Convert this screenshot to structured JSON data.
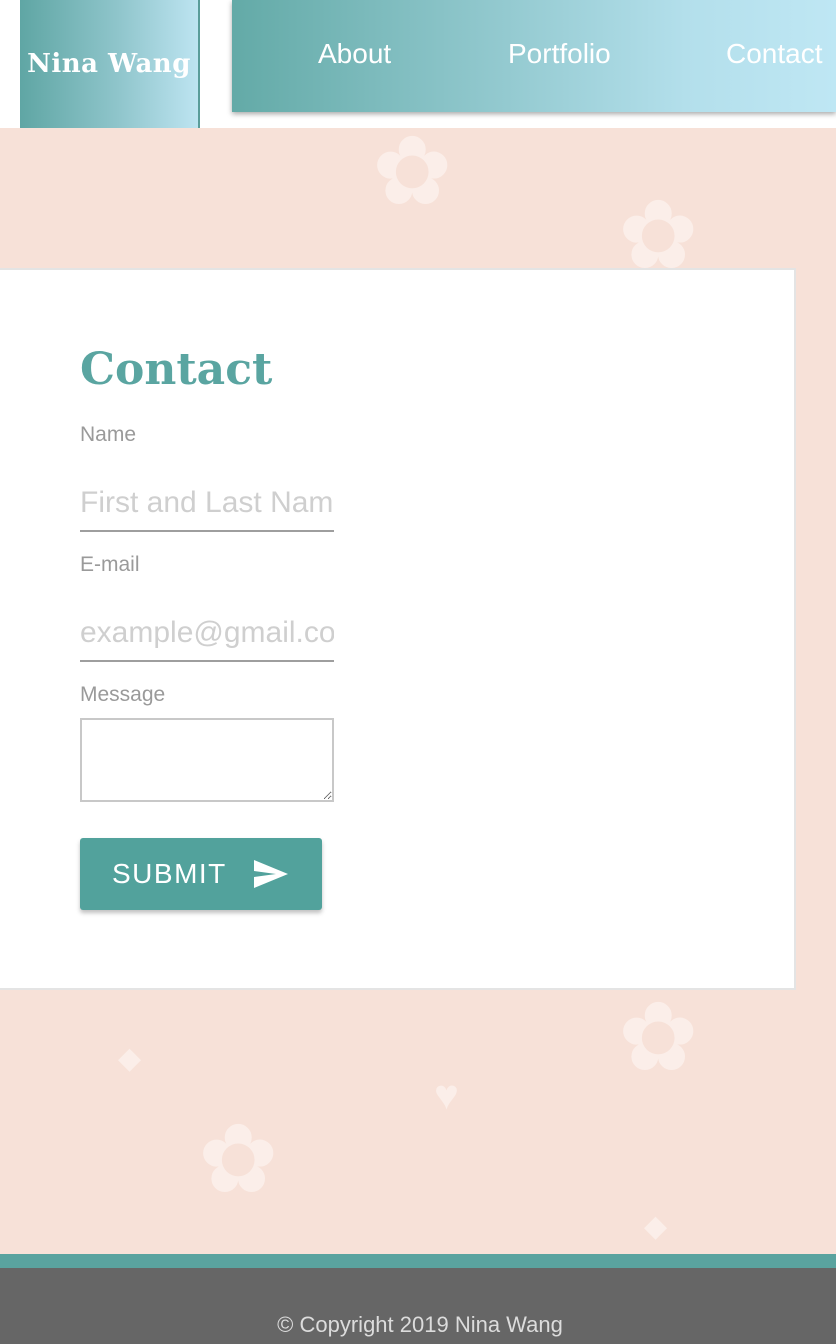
{
  "header": {
    "logo_text": "Nina Wang",
    "nav": {
      "about": "About",
      "portfolio": "Portfolio",
      "contact": "Contact"
    }
  },
  "contact_form": {
    "title": "Contact",
    "name": {
      "label": "Name",
      "placeholder": "First and Last Name",
      "value": ""
    },
    "email": {
      "label": "E-mail",
      "placeholder": "example@gmail.com",
      "value": ""
    },
    "message": {
      "label": "Message",
      "value": ""
    },
    "submit_label": "SUBMIT",
    "submit_icon": "send-icon"
  },
  "footer": {
    "copyright": "© Copyright 2019 Nina Wang"
  },
  "colors": {
    "accent": "#5aa5a1",
    "background": "#f7e1d8",
    "footer": "#666666"
  }
}
